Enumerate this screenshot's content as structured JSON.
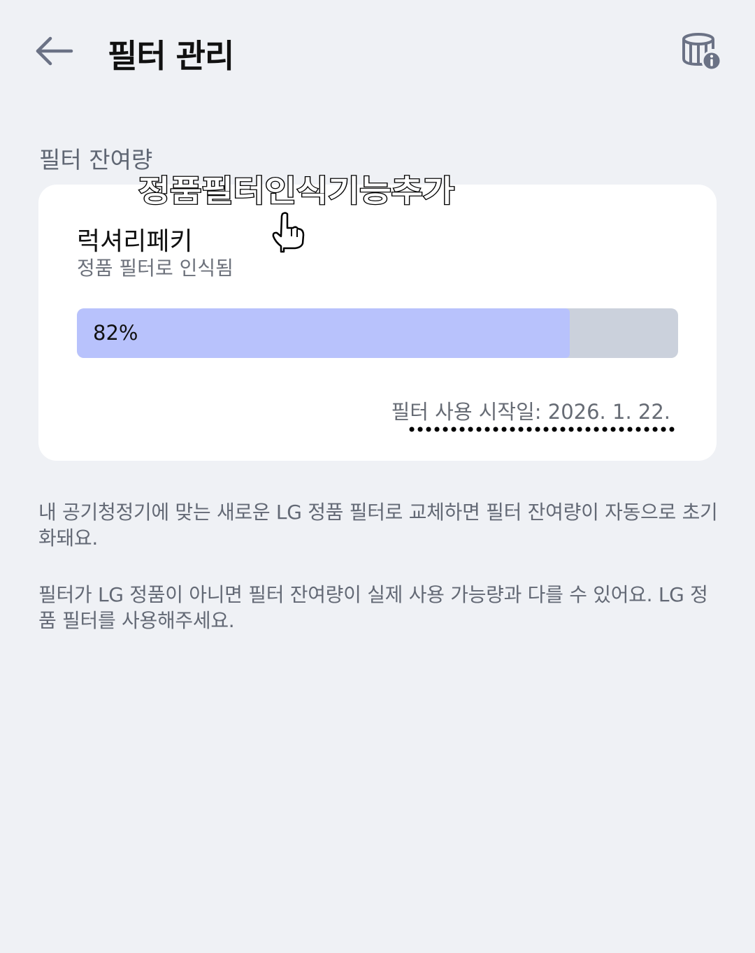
{
  "header": {
    "title": "필터 관리",
    "back_icon": "arrow-left-icon",
    "info_icon": "filter-info-icon"
  },
  "section": {
    "label": "필터 잔여량"
  },
  "overlay": {
    "text": "정품필터인식기능추가",
    "hand_icon": "pointing-hand-icon"
  },
  "filter": {
    "name": "럭셔리페키",
    "status": "정품 필터로 인식됨",
    "remaining_text": "82%",
    "remaining_fraction": 0.82,
    "start_date": "필터 사용 시작일: 2026. 1. 22."
  },
  "descriptions": [
    "내 공기청정기에 맞는 새로운 LG 정품 필터로 교체하면 필터 잔여량이 자동으로 초기화돼요.",
    "필터가 LG 정품이 아니면 필터 잔여량이 실제 사용 가능량과 다를 수 있어요. LG 정품 필터를 사용해주세요."
  ],
  "colors": {
    "background": "#eff1f5",
    "card": "#ffffff",
    "progress_fill": "#b8c2fc",
    "progress_track": "#cbd1dc",
    "icon": "#6b7285"
  }
}
